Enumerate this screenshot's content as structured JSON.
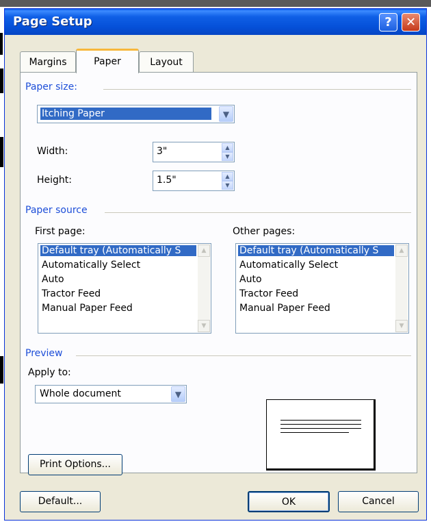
{
  "window": {
    "title": "Page Setup",
    "help_glyph": "?",
    "close_glyph": "✕"
  },
  "tabs": [
    {
      "label": "Margins",
      "active": false
    },
    {
      "label": "Paper",
      "active": true
    },
    {
      "label": "Layout",
      "active": false
    }
  ],
  "paper_size": {
    "section_label": "Paper size:",
    "selected": "Itching Paper",
    "width_label": "Width:",
    "width_value": "3\"",
    "height_label": "Height:",
    "height_value": "1.5\""
  },
  "paper_source": {
    "section_label": "Paper source",
    "first_page_label": "First page:",
    "other_pages_label": "Other pages:",
    "first_page_items": [
      {
        "label": "Default tray (Automatically S",
        "selected": true
      },
      {
        "label": "Automatically Select",
        "selected": false
      },
      {
        "label": "Auto",
        "selected": false
      },
      {
        "label": "Tractor Feed",
        "selected": false
      },
      {
        "label": "Manual Paper Feed",
        "selected": false
      }
    ],
    "other_pages_items": [
      {
        "label": "Default tray (Automatically S",
        "selected": true
      },
      {
        "label": "Automatically Select",
        "selected": false
      },
      {
        "label": "Auto",
        "selected": false
      },
      {
        "label": "Tractor Feed",
        "selected": false
      },
      {
        "label": "Manual Paper Feed",
        "selected": false
      }
    ]
  },
  "preview": {
    "section_label": "Preview",
    "apply_to_label": "Apply to:",
    "apply_to_value": "Whole document"
  },
  "buttons": {
    "print_options": "Print Options...",
    "default": "Default...",
    "ok": "OK",
    "cancel": "Cancel"
  },
  "icons": {
    "dropdown": "chevron-down-icon",
    "spin_up": "spin-up-icon",
    "spin_down": "spin-down-icon",
    "scroll_up": "scroll-up-icon",
    "scroll_down": "scroll-down-icon"
  },
  "colors": {
    "titlebar": "#0054e3",
    "dialog_face": "#ece9d8",
    "section_text": "#1d4ed8",
    "selection": "#316ac5",
    "active_tab_accent": "#f8b73c"
  }
}
